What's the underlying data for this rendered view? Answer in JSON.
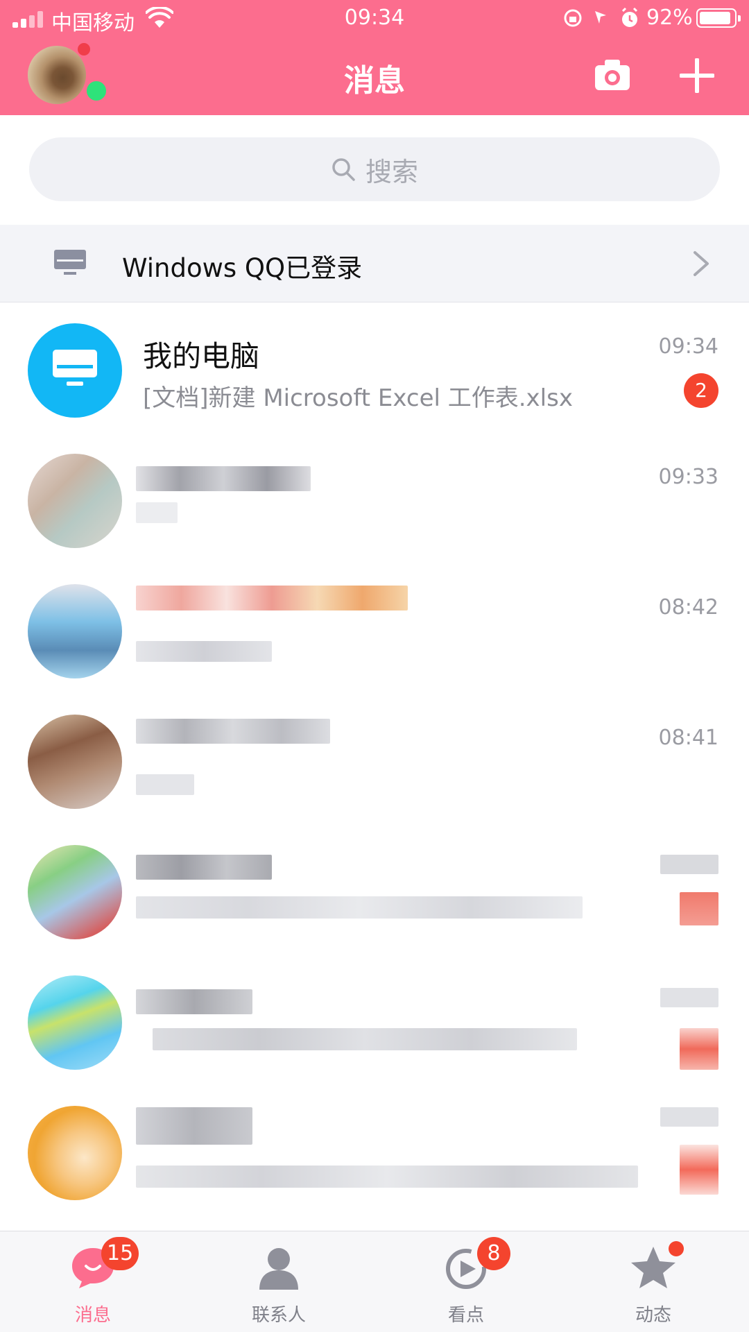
{
  "status_bar": {
    "carrier": "中国移动",
    "time": "09:34",
    "battery": "92%"
  },
  "nav": {
    "title": "消息"
  },
  "search": {
    "placeholder": "搜索"
  },
  "banner": {
    "text": "Windows QQ已登录"
  },
  "conversations": [
    {
      "name": "我的电脑",
      "preview": "[文档]新建 Microsoft Excel 工作表.xlsx",
      "time": "09:34",
      "unread": "2"
    },
    {
      "name": "",
      "preview": "",
      "time": "09:33"
    },
    {
      "name": "",
      "preview": "",
      "time": "08:42"
    },
    {
      "name": "",
      "preview": "",
      "time": "08:41"
    }
  ],
  "tabs": [
    {
      "label": "消息",
      "badge": "15"
    },
    {
      "label": "联系人"
    },
    {
      "label": "看点",
      "badge": "8"
    },
    {
      "label": "动态"
    }
  ],
  "colors": {
    "brand": "#fc6d8e",
    "badge": "#f4442e",
    "pc_avatar": "#12b7f5"
  }
}
